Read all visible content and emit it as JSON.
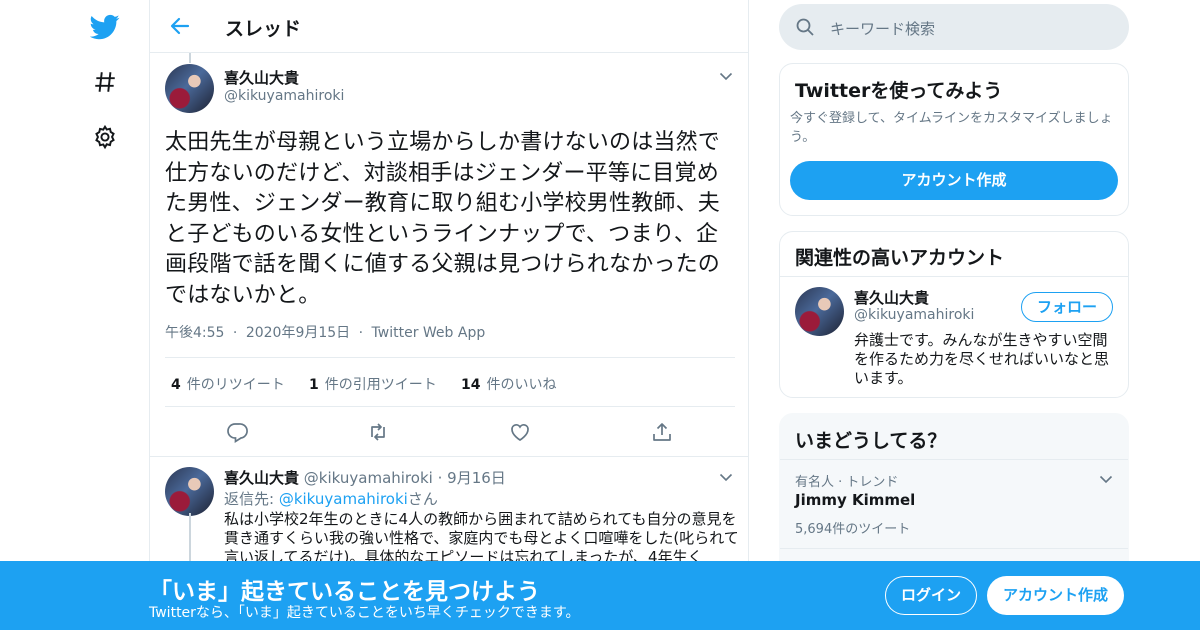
{
  "header": {
    "title": "スレッド"
  },
  "tweet": {
    "name": "喜久山大貴",
    "handle": "@kikuyamahiroki",
    "text": "太田先生が母親という立場からしか書けないのは当然で仕方ないのだけど、対談相手はジェンダー平等に目覚めた男性、ジェンダー教育に取り組む小学校男性教師、夫と子どものいる女性というラインナップで、つまり、企画段階で話を聞くに値する父親は見つけられなかったのではないかと。",
    "time": "午後4:55",
    "date": "2020年9月15日",
    "source": "Twitter Web App",
    "sep": "·",
    "retweets_count": "4",
    "retweets_label": "件のリツイート",
    "quotes_count": "1",
    "quotes_label": "件の引用ツイート",
    "likes_count": "14",
    "likes_label": "件のいいね"
  },
  "reply": {
    "name": "喜久山大貴",
    "handle": "@kikuyamahiroki",
    "date": "9月16日",
    "replying_prefix": "返信先: ",
    "replying_handle": "@kikuyamahiroki",
    "replying_suffix": "さん",
    "text": "私は小学校2年生のときに4人の教師から囲まれて詰められても自分の意見を貫き通すくらい我の強い性格で、家庭内でも母とよく口喧嘩をした(叱られて言い返してるだけ)。具体的なエピソードは忘れてしまったが、4年生く"
  },
  "search": {
    "placeholder": "キーワード検索"
  },
  "signup_card": {
    "title": "Twitterを使ってみよう",
    "body": "今すぐ登録して、タイムラインをカスタマイズしましょう。",
    "button": "アカウント作成"
  },
  "related_card": {
    "title": "関連性の高いアカウント",
    "name": "喜久山大貴",
    "handle": "@kikuyamahiroki",
    "follow": "フォロー",
    "bio": "弁護士です。みんなが生きやすい空間を作るため力を尽くせればいいなと思います。"
  },
  "trends_card": {
    "title": "いまどうしてる？",
    "trend_context": "有名人 · トレンド",
    "trend_name": "Jimmy Kimmel",
    "trend_count": "5,694件のツイート"
  },
  "banner": {
    "headline": "「いま」起きていることを見つけよう",
    "sub": "Twitterなら、「いま」起きていることをいち早くチェックできます。",
    "login": "ログイン",
    "signup": "アカウント作成"
  },
  "colors": {
    "accent": "#1da1f2",
    "text": "#14171a",
    "secondary": "#657786",
    "border": "#e6ecf0"
  }
}
